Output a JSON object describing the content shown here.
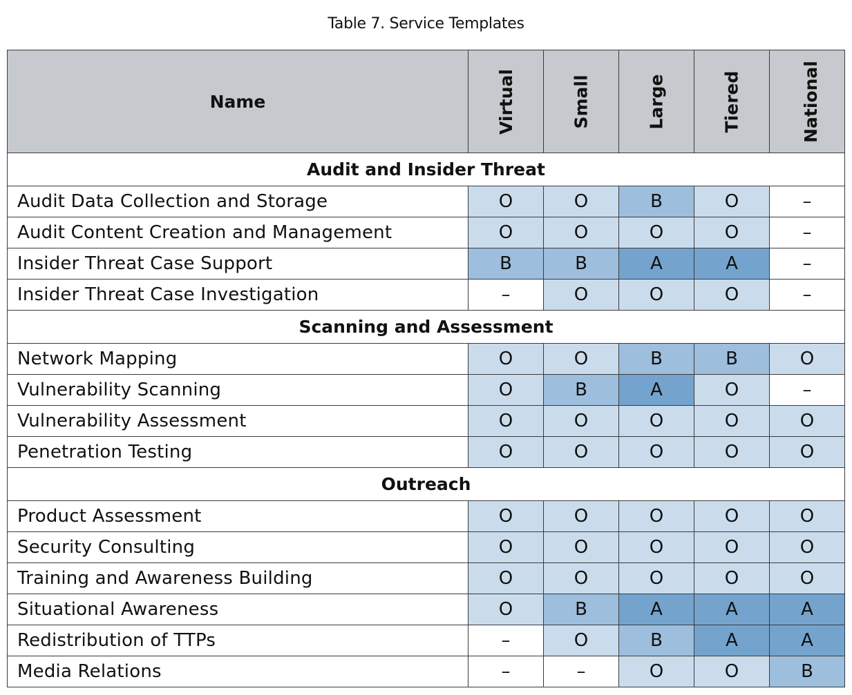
{
  "caption": "Table 7. Service Templates",
  "header": {
    "name_label": "Name",
    "columns": [
      "Virtual",
      "Small",
      "Large",
      "Tiered",
      "National"
    ]
  },
  "legend_colors": {
    "O": "#cadcec",
    "B": "#9dbedc",
    "A": "#74a4cd",
    "–": "#ffffff"
  },
  "sections": [
    {
      "title": "Audit and Insider Threat",
      "rows": [
        {
          "name": "Audit Data Collection and Storage",
          "values": [
            "O",
            "O",
            "B",
            "O",
            "–"
          ]
        },
        {
          "name": "Audit Content Creation and Management",
          "values": [
            "O",
            "O",
            "O",
            "O",
            "–"
          ]
        },
        {
          "name": "Insider Threat Case Support",
          "values": [
            "B",
            "B",
            "A",
            "A",
            "–"
          ]
        },
        {
          "name": "Insider Threat Case Investigation",
          "values": [
            "–",
            "O",
            "O",
            "O",
            "–"
          ]
        }
      ]
    },
    {
      "title": "Scanning and Assessment",
      "rows": [
        {
          "name": "Network Mapping",
          "values": [
            "O",
            "O",
            "B",
            "B",
            "O"
          ]
        },
        {
          "name": "Vulnerability Scanning",
          "values": [
            "O",
            "B",
            "A",
            "O",
            "–"
          ]
        },
        {
          "name": "Vulnerability Assessment",
          "values": [
            "O",
            "O",
            "O",
            "O",
            "O"
          ]
        },
        {
          "name": "Penetration Testing",
          "values": [
            "O",
            "O",
            "O",
            "O",
            "O"
          ]
        }
      ]
    },
    {
      "title": "Outreach",
      "rows": [
        {
          "name": "Product Assessment",
          "values": [
            "O",
            "O",
            "O",
            "O",
            "O"
          ]
        },
        {
          "name": "Security Consulting",
          "values": [
            "O",
            "O",
            "O",
            "O",
            "O"
          ]
        },
        {
          "name": "Training and Awareness Building",
          "values": [
            "O",
            "O",
            "O",
            "O",
            "O"
          ]
        },
        {
          "name": "Situational Awareness",
          "values": [
            "O",
            "B",
            "A",
            "A",
            "A"
          ]
        },
        {
          "name": "Redistribution of TTPs",
          "values": [
            "–",
            "O",
            "B",
            "A",
            "A"
          ]
        },
        {
          "name": "Media Relations",
          "values": [
            "–",
            "–",
            "O",
            "O",
            "B"
          ]
        }
      ]
    }
  ]
}
